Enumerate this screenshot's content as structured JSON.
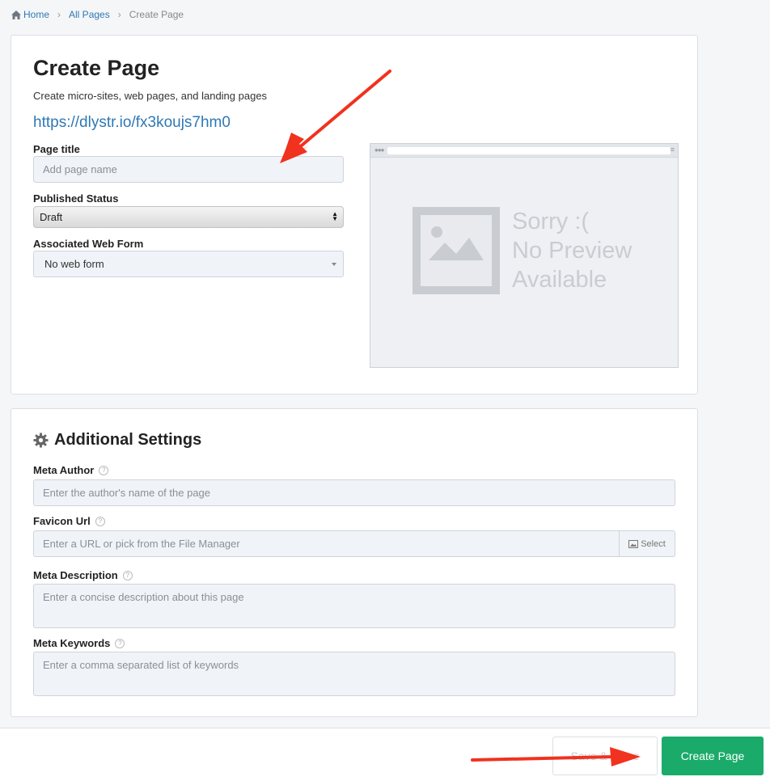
{
  "breadcrumb": {
    "home": "Home",
    "all_pages": "All Pages",
    "current": "Create Page"
  },
  "main": {
    "title": "Create Page",
    "subtitle": "Create micro-sites, web pages, and landing pages",
    "url": "https://dlystr.io/fx3koujs7hm0",
    "page_title_label": "Page title",
    "page_title_placeholder": "Add page name",
    "published_status_label": "Published Status",
    "published_status_value": "Draft",
    "web_form_label": "Associated Web Form",
    "web_form_value": "No web form"
  },
  "preview": {
    "message": "Sorry :(\nNo Preview\nAvailable"
  },
  "settings": {
    "heading": "Additional Settings",
    "meta_author_label": "Meta Author",
    "meta_author_placeholder": "Enter the author's name of the page",
    "favicon_label": "Favicon Url",
    "favicon_placeholder": "Enter a URL or pick from the File Manager",
    "favicon_select": "Select",
    "meta_description_label": "Meta Description",
    "meta_description_placeholder": "Enter a concise description about this page",
    "meta_keywords_label": "Meta Keywords",
    "meta_keywords_placeholder": "Enter a comma separated list of keywords",
    "help_glyph": "?"
  },
  "footer": {
    "save_close": "Save & Close",
    "create_page": "Create Page"
  },
  "colors": {
    "link": "#2f78b4",
    "primary_button": "#1aab6b",
    "annotation_arrow": "#f0321e"
  }
}
